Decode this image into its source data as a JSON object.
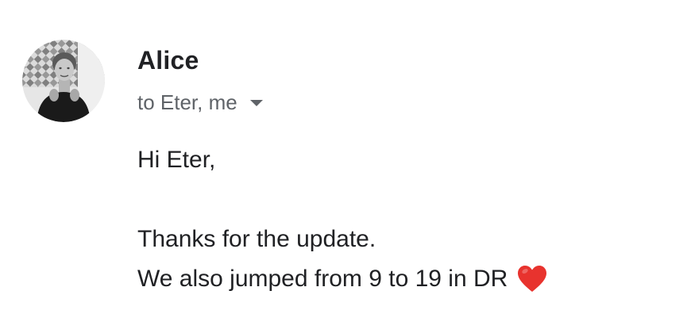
{
  "message": {
    "sender_name": "Alice",
    "recipients": "to Eter, me",
    "greeting": "Hi Eter,",
    "body_line_1": "Thanks for the update.",
    "body_line_2": "We also jumped from 9 to 19 in DR"
  },
  "icons": {
    "recipients_toggle": "chevron-down-icon",
    "emoji": "red-heart-icon"
  },
  "colors": {
    "heart": "#E8332E",
    "secondary_text": "#5f6368",
    "primary_text": "#202124"
  }
}
